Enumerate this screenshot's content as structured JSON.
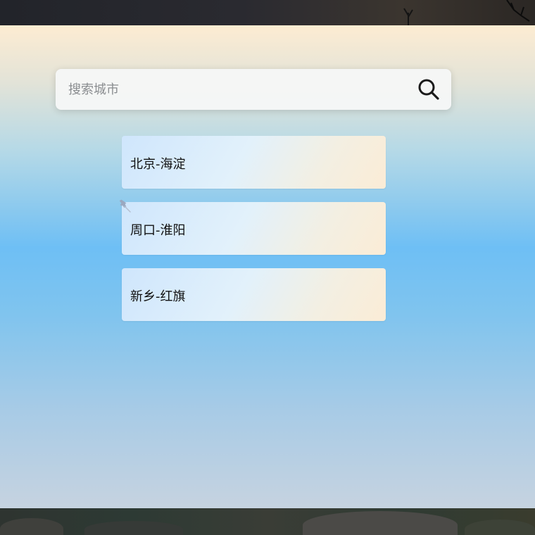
{
  "search": {
    "placeholder": "搜索城市",
    "value": ""
  },
  "cities": [
    {
      "label": "北京-海淀",
      "pinned": false
    },
    {
      "label": "周口-淮阳",
      "pinned": true
    },
    {
      "label": "新乡-红旗",
      "pinned": false
    }
  ],
  "icons": {
    "search": "search-icon",
    "pin": "pin-icon"
  },
  "colors": {
    "panel_top": "#fdecd2",
    "panel_mid": "#6ebff5",
    "panel_bottom": "#c6d3e0",
    "card_left": "#cfe6fc",
    "card_right": "#fbecd6",
    "pin": "#9aa8c0"
  }
}
